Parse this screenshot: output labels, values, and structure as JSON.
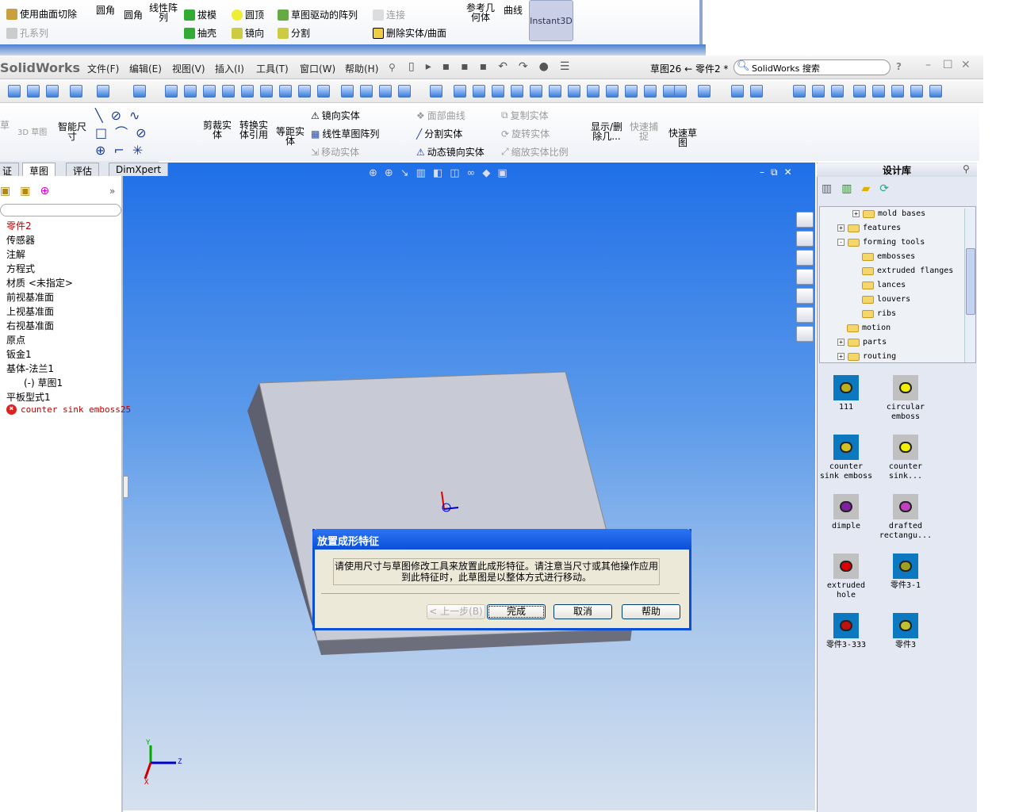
{
  "prev_window": {
    "items": [
      "使用曲面切除",
      "孔系列",
      "圆角",
      "圆角",
      "线性阵列",
      "拔模",
      "圆顶",
      "草图驱动的阵列",
      "连接",
      "抽壳",
      "镜向",
      "分割",
      "删除实体/曲面",
      "参考几何体",
      "曲线",
      "Instant3D"
    ]
  },
  "app": {
    "logo": "SolidWorks",
    "doc_title": "草图26 ← 零件2 *",
    "search_placeholder": "SolidWorks 搜索",
    "help": "?"
  },
  "menu": [
    "文件(F)",
    "编辑(E)",
    "视图(V)",
    "插入(I)",
    "工具(T)",
    "窗口(W)",
    "帮助(H)"
  ],
  "ribbon": {
    "left": [
      "草",
      "3D 草图",
      "智能尺寸"
    ],
    "big": [
      "剪裁实体",
      "转换实体引用",
      "等距实体"
    ],
    "col1": [
      "镜向实体",
      "线性草图阵列",
      "移动实体"
    ],
    "col2": [
      "面部曲线",
      "分割实体",
      "动态镜向实体"
    ],
    "col3": [
      "复制实体",
      "旋转实体",
      "缩放实体比例"
    ],
    "right": [
      "显示/删除几...",
      "快速捕捉",
      "快速草图"
    ]
  },
  "tabs": [
    "证",
    "草图",
    "评估",
    "DimXpert"
  ],
  "tree": {
    "items": [
      "零件2",
      "传感器",
      "注解",
      "方程式",
      "材质 <未指定>",
      "前视基准面",
      "上视基准面",
      "右视基准面",
      "原点",
      "钣金1",
      "基体-法兰1",
      "(-) 草图1",
      "平板型式1",
      "counter sink emboss25"
    ]
  },
  "design_library": {
    "title": "设计库",
    "folders": [
      {
        "label": "mold bases",
        "expand": "+"
      },
      {
        "label": "features",
        "expand": "+"
      },
      {
        "label": "forming tools",
        "expand": "-"
      },
      {
        "label": "embosses"
      },
      {
        "label": "extruded flanges"
      },
      {
        "label": "lances"
      },
      {
        "label": "louvers"
      },
      {
        "label": "ribs"
      },
      {
        "label": "motion"
      },
      {
        "label": "parts",
        "expand": "+"
      },
      {
        "label": "routing",
        "expand": "+"
      }
    ],
    "items": [
      "111",
      "circular emboss",
      "counter sink emboss",
      "counter sink...",
      "dimple",
      "drafted rectangu...",
      "extruded hole",
      "零件3-1",
      "零件3-333",
      "零件3"
    ]
  },
  "dialog": {
    "title": "放置成形特征",
    "message_line1": "请使用尺寸与草图修改工具来放置此成形特征。请注意当尺寸或其他操作应用",
    "message_line2": "到此特征时，此草图是以整体方式进行移动。",
    "back": "< 上一步(B)",
    "finish": "完成",
    "cancel": "取消",
    "help": "帮助"
  },
  "triad": {
    "x": "X",
    "y": "Y",
    "z": "Z"
  },
  "colors": {
    "viewport_top": "#1f6fe8",
    "dialog_title": "#0a50d8",
    "error": "#cc0000"
  }
}
